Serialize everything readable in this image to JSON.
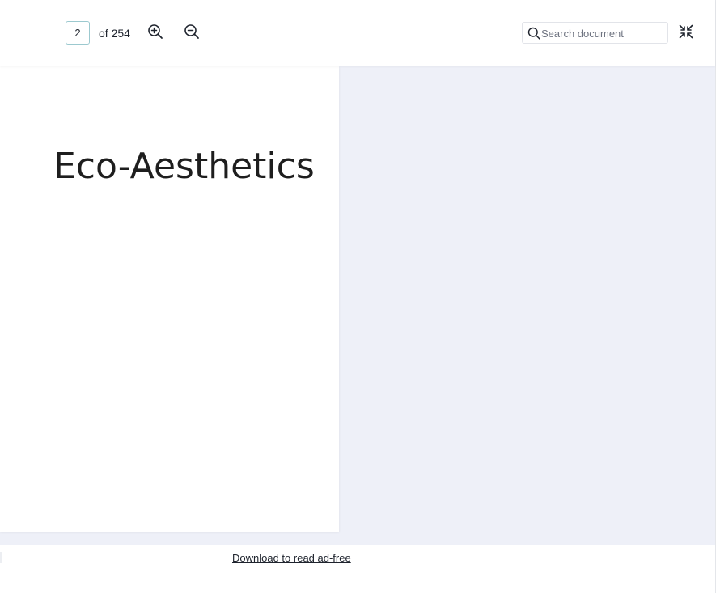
{
  "toolbar": {
    "page_number": "2",
    "page_total": "of 254",
    "zoom_in_icon": "zoom-in-icon",
    "zoom_out_icon": "zoom-out-icon",
    "search_placeholder": "Search document",
    "search_value": "",
    "collapse_icon": "collapse-icon"
  },
  "document": {
    "page_title": "Eco-Aesthetics"
  },
  "footer": {
    "download_link": "Download to read ad-free"
  },
  "colors": {
    "viewer_background": "#eef0f8",
    "page_background": "#ffffff",
    "text": "#1e232d",
    "page_input_border": "#9cc9cf"
  }
}
